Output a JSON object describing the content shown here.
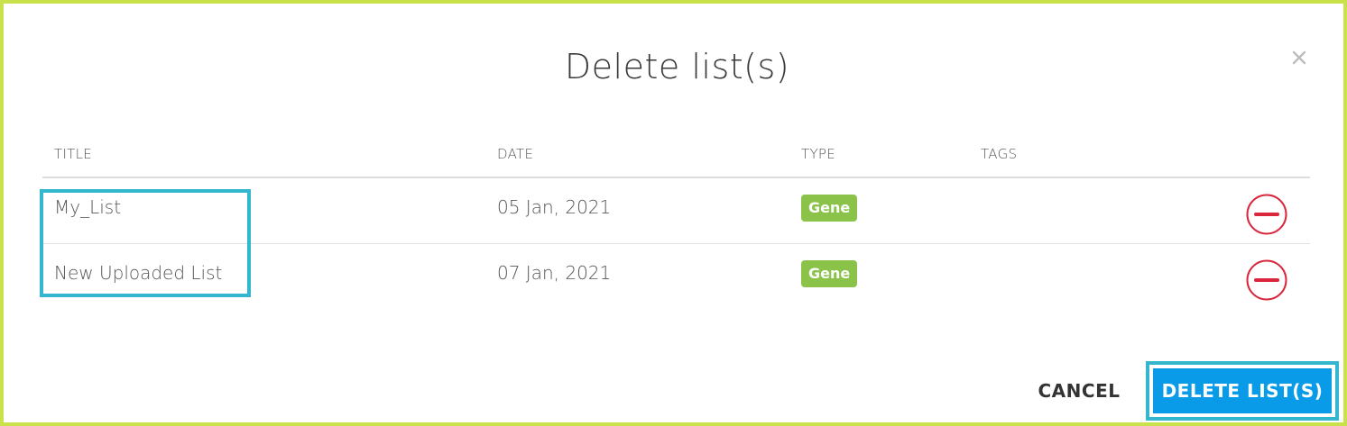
{
  "dialog": {
    "title": "Delete list(s)",
    "close_icon": "close-icon"
  },
  "table": {
    "headers": {
      "title": "TITLE",
      "date": "DATE",
      "type": "TYPE",
      "tags": "TAGS"
    },
    "rows": [
      {
        "title": "My_List",
        "date": "05 Jan, 2021",
        "type": "Gene",
        "tags": ""
      },
      {
        "title": "New Uploaded List",
        "date": "07 Jan, 2021",
        "type": "Gene",
        "tags": ""
      }
    ]
  },
  "footer": {
    "cancel_label": "CANCEL",
    "delete_label": "DELETE LIST(S)"
  },
  "colors": {
    "frame_border": "#c9e14a",
    "highlight": "#35b6cf",
    "primary": "#0a9be8",
    "badge": "#8bc34a",
    "remove": "#d9263c"
  },
  "icons": {
    "remove": "minus-circle-icon"
  }
}
